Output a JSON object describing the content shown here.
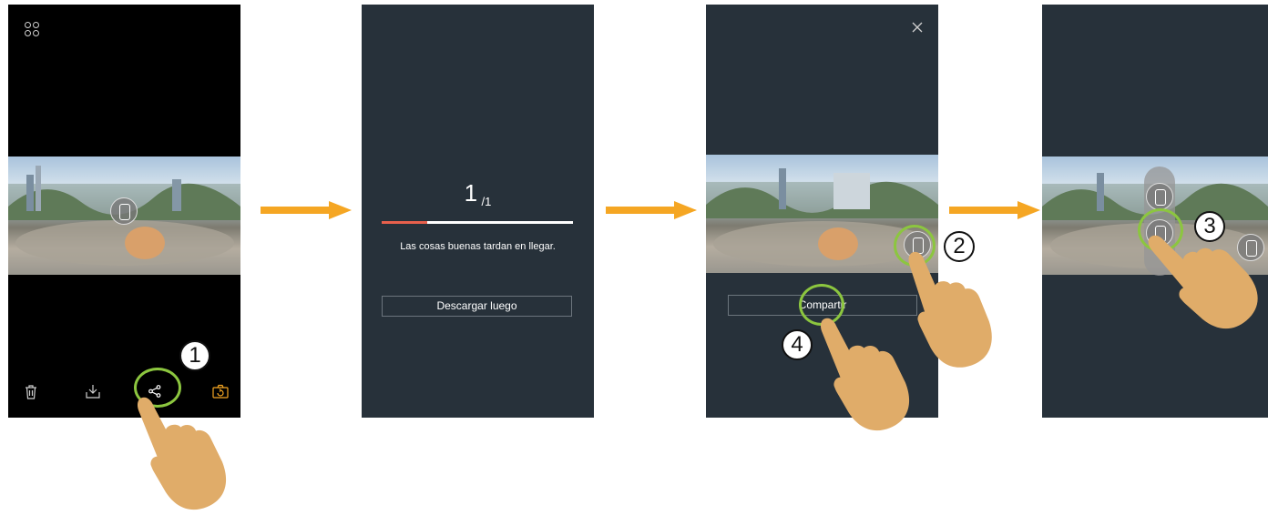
{
  "screen1": {
    "toolbar": {
      "delete_icon": "trash-icon",
      "download_icon": "download-icon",
      "share_icon": "share-icon",
      "camera_icon": "camera-switch-icon"
    },
    "menu_icon": "grid-icon",
    "step_number": "1"
  },
  "screen2": {
    "counter_current": "1",
    "counter_total": "/1",
    "progress": 0.24,
    "message": "Las cosas buenas tardan en llegar.",
    "later_button": "Descargar luego"
  },
  "screen3": {
    "close_icon": "close-icon",
    "share_button": "Compartir",
    "step_numbers": [
      "2",
      "4"
    ]
  },
  "screen4": {
    "step_number": "3"
  },
  "colors": {
    "panel_bg": "#27313a",
    "arrow": "#f5a623",
    "highlight_ring": "#8cc63f",
    "progress_fill": "#e8604c",
    "hand": "#e0ac69"
  }
}
